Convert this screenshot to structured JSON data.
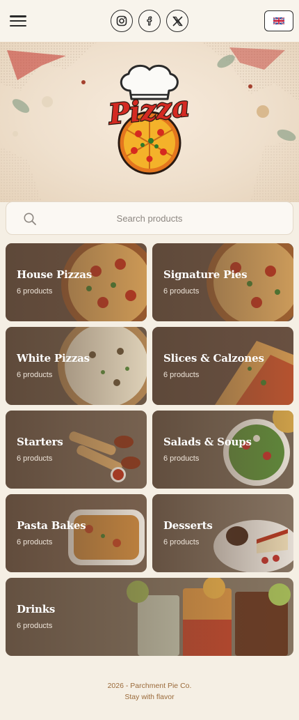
{
  "header": {
    "menu_icon": "hamburger-menu-icon",
    "socials": [
      {
        "name": "instagram",
        "icon": "instagram-icon"
      },
      {
        "name": "facebook",
        "icon": "facebook-icon"
      },
      {
        "name": "x",
        "icon": "x-icon"
      }
    ],
    "language_flag": "uk-flag-icon"
  },
  "hero": {
    "logo_text": "Pizza"
  },
  "search": {
    "placeholder": "Search products",
    "value": ""
  },
  "categories": [
    {
      "title": "House Pizzas",
      "count": "6 products"
    },
    {
      "title": "Signature Pies",
      "count": "6 products"
    },
    {
      "title": "White Pizzas",
      "count": "6 products"
    },
    {
      "title": "Slices & Calzones",
      "count": "6 products"
    },
    {
      "title": "Starters",
      "count": "6 products"
    },
    {
      "title": "Salads & Soups",
      "count": "6 products"
    },
    {
      "title": "Pasta Bakes",
      "count": "6 products"
    },
    {
      "title": "Desserts",
      "count": "6 products"
    },
    {
      "title": "Drinks",
      "count": "6 products"
    }
  ],
  "footer": {
    "line1": "2026 - Parchment Pie Co.",
    "line2": "Stay with flavor"
  },
  "colors": {
    "background": "#f5efe4",
    "accent": "#c8201e",
    "footer_text": "#9a6a3a",
    "card_overlay": "#5a4637"
  }
}
